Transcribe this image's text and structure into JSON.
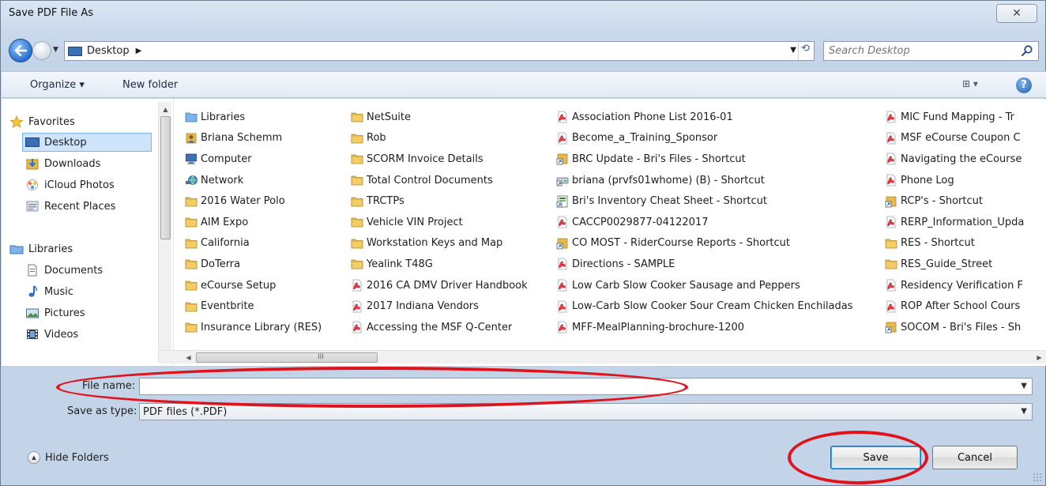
{
  "window": {
    "title": "Save PDF File As",
    "close_glyph": "✕"
  },
  "address_bar": {
    "location": "Desktop",
    "search_placeholder": "Search Desktop"
  },
  "toolbar": {
    "organize": "Organize ▾",
    "new_folder": "New folder",
    "view_glyph": "⊞ ▾",
    "help": "?"
  },
  "nav_pane": {
    "favorites_label": "Favorites",
    "favorites": [
      {
        "label": "Desktop",
        "icon": "desktop-icon",
        "selected": true
      },
      {
        "label": "Downloads",
        "icon": "downloads-icon"
      },
      {
        "label": "iCloud Photos",
        "icon": "icloud-icon"
      },
      {
        "label": "Recent Places",
        "icon": "recent-places-icon"
      }
    ],
    "libraries_label": "Libraries",
    "libraries": [
      {
        "label": "Documents",
        "icon": "documents-icon"
      },
      {
        "label": "Music",
        "icon": "music-icon"
      },
      {
        "label": "Pictures",
        "icon": "pictures-icon"
      },
      {
        "label": "Videos",
        "icon": "videos-icon"
      }
    ]
  },
  "files": {
    "columns": [
      [
        {
          "name": "Libraries",
          "icon": "library"
        },
        {
          "name": "Briana Schemm",
          "icon": "user"
        },
        {
          "name": "Computer",
          "icon": "computer"
        },
        {
          "name": "Network",
          "icon": "network"
        },
        {
          "name": "2016 Water Polo",
          "icon": "folder"
        },
        {
          "name": "AIM Expo",
          "icon": "folder"
        },
        {
          "name": "California",
          "icon": "folder"
        },
        {
          "name": "DoTerra",
          "icon": "folder"
        },
        {
          "name": "eCourse Setup",
          "icon": "folder"
        },
        {
          "name": "Eventbrite",
          "icon": "folder"
        },
        {
          "name": "Insurance Library (RES)",
          "icon": "folder"
        }
      ],
      [
        {
          "name": "NetSuite",
          "icon": "folder"
        },
        {
          "name": "Rob",
          "icon": "folder"
        },
        {
          "name": "SCORM Invoice Details",
          "icon": "folder"
        },
        {
          "name": "Total Control Documents",
          "icon": "folder"
        },
        {
          "name": "TRCTPs",
          "icon": "folder"
        },
        {
          "name": "Vehicle VIN Project",
          "icon": "folder"
        },
        {
          "name": "Workstation Keys and Map",
          "icon": "folder"
        },
        {
          "name": "Yealink T48G",
          "icon": "folder"
        },
        {
          "name": "2016 CA DMV Driver Handbook",
          "icon": "pdf"
        },
        {
          "name": "2017 Indiana Vendors",
          "icon": "pdf"
        },
        {
          "name": "Accessing the MSF Q-Center",
          "icon": "pdf"
        }
      ],
      [
        {
          "name": "Association Phone List 2016-01",
          "icon": "pdf"
        },
        {
          "name": "Become_a_Training_Sponsor",
          "icon": "pdf"
        },
        {
          "name": "BRC Update - Bri's Files - Shortcut",
          "icon": "shortcut"
        },
        {
          "name": "briana (prvfs01whome) (B) - Shortcut",
          "icon": "drive-shortcut"
        },
        {
          "name": "Bri's Inventory Cheat Sheet - Shortcut",
          "icon": "excel-shortcut"
        },
        {
          "name": "CACCP0029877-04122017",
          "icon": "pdf"
        },
        {
          "name": "CO MOST - RiderCourse Reports - Shortcut",
          "icon": "shortcut"
        },
        {
          "name": "Directions - SAMPLE",
          "icon": "pdf"
        },
        {
          "name": "Low Carb Slow Cooker Sausage and Peppers",
          "icon": "pdf"
        },
        {
          "name": "Low-Carb Slow Cooker Sour Cream Chicken Enchiladas",
          "icon": "pdf"
        },
        {
          "name": "MFF-MealPlanning-brochure-1200",
          "icon": "pdf"
        }
      ],
      [
        {
          "name": "MIC Fund Mapping - Tr",
          "icon": "pdf"
        },
        {
          "name": "MSF eCourse Coupon C",
          "icon": "pdf"
        },
        {
          "name": "Navigating the eCourse",
          "icon": "pdf"
        },
        {
          "name": "Phone Log",
          "icon": "pdf"
        },
        {
          "name": "RCP's - Shortcut",
          "icon": "shortcut"
        },
        {
          "name": "RERP_Information_Upda",
          "icon": "pdf"
        },
        {
          "name": "RES - Shortcut",
          "icon": "folder"
        },
        {
          "name": "RES_Guide_Street",
          "icon": "folder"
        },
        {
          "name": "Residency Verification F",
          "icon": "pdf"
        },
        {
          "name": "ROP After School Cours",
          "icon": "pdf"
        },
        {
          "name": "SOCOM - Bri's Files - Sh",
          "icon": "shortcut"
        }
      ]
    ]
  },
  "scroll": {
    "grip": "III"
  },
  "form": {
    "file_name_label": "File name:",
    "file_name_value": "",
    "save_type_label": "Save as type:",
    "save_type_value": "PDF files (*.PDF)"
  },
  "footer": {
    "hide_folders": "Hide Folders",
    "save": "Save",
    "cancel": "Cancel"
  },
  "colors": {
    "annotation": "#e0121b",
    "pdf": "#d0202a",
    "folder": "#e8b94a",
    "accent": "#3ba7e7"
  }
}
